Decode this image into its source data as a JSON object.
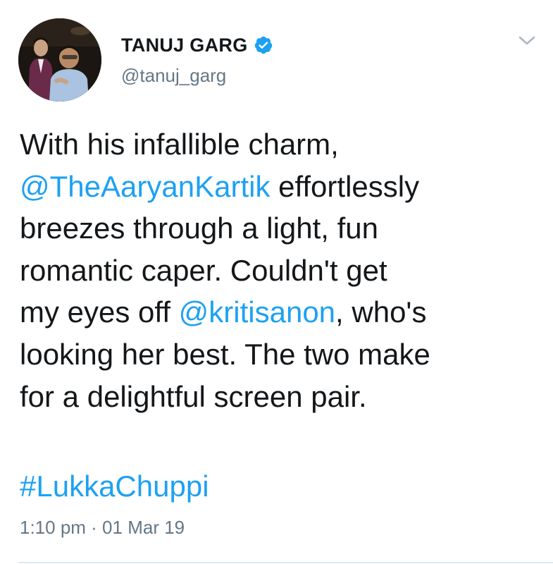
{
  "author": {
    "display_name": "TANUJ GARG",
    "handle": "@tanuj_garg",
    "verified": true,
    "avatar_icon": "profile-photo"
  },
  "menu": {
    "icon": "chevron-down-icon"
  },
  "tweet": {
    "lines": [
      {
        "segments": [
          {
            "text": "With his infallible charm,",
            "type": "text"
          }
        ]
      },
      {
        "segments": [
          {
            "text": "@TheAaryanKartik",
            "type": "mention"
          },
          {
            "text": " effortlessly",
            "type": "text"
          }
        ]
      },
      {
        "segments": [
          {
            "text": "breezes through a light, fun",
            "type": "text"
          }
        ]
      },
      {
        "segments": [
          {
            "text": "romantic caper. Couldn't get",
            "type": "text"
          }
        ]
      },
      {
        "segments": [
          {
            "text": "my eyes off ",
            "type": "text"
          },
          {
            "text": "@kritisanon",
            "type": "mention"
          },
          {
            "text": ", who's",
            "type": "text"
          }
        ]
      },
      {
        "segments": [
          {
            "text": "looking her best. The two make",
            "type": "text"
          }
        ]
      },
      {
        "segments": [
          {
            "text": "for a delightful screen pair.",
            "type": "text"
          }
        ]
      }
    ],
    "hashtag": "#LukkaChuppi",
    "timestamp": "1:10 pm · 01 Mar 19"
  },
  "colors": {
    "link": "#1da1f2",
    "text": "#14171a",
    "secondary": "#657786",
    "verified_badge": "#1da1f2"
  }
}
